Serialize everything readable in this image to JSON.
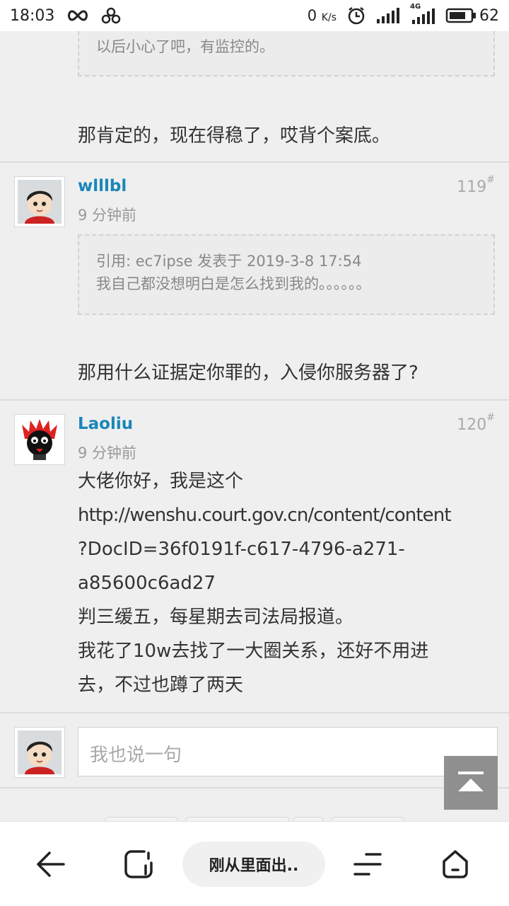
{
  "status_bar": {
    "time": "18:03",
    "net_speed": "0",
    "net_unit": "K/s",
    "network_type": "4G",
    "battery": "62",
    "icons": [
      "infinity-icon",
      "pinwheel-icon",
      "alarm-icon",
      "signal-icon",
      "signal-4g-icon",
      "battery-icon"
    ]
  },
  "thread": {
    "quote_partial_text": "以后小心了吧，有监控的。",
    "reply_partial_text": "那肯定的，现在得稳了，哎背个案底。",
    "posts": [
      {
        "username": "wlllbl",
        "time": "9 分钟前",
        "floor": "119",
        "floor_mark": "#",
        "quote_header": "引用: ec7ipse 发表于 2019-3-8 17:54",
        "quote_text": "我自己都没想明白是怎么找到我的。。。。。。",
        "text": "那用什么证据定你罪的，入侵你服务器了?"
      },
      {
        "username": "Laoliu",
        "time": "9 分钟前",
        "floor": "120",
        "floor_mark": "#",
        "lines": [
          "大佬你好，我是这个",
          "http://wenshu.court.gov.cn/content/content",
          "?DocID=36f0191f-c617-4796-a271-",
          "a85600c6ad27",
          "判三缓五，每星期去司法局报道。",
          "我花了10w去找了一大圈关系，还好不用进",
          "去，不过也蹲了两天"
        ]
      }
    ]
  },
  "reply_box": {
    "placeholder": "我也说一句"
  },
  "bottom_bar": {
    "page_title": "刚从里面出..",
    "icons": [
      "back-arrow-icon",
      "tabs-icon",
      "menu-icon",
      "home-icon"
    ]
  },
  "colors": {
    "username": "#1a86b8",
    "background": "#efefef",
    "muted_text": "#999999"
  }
}
